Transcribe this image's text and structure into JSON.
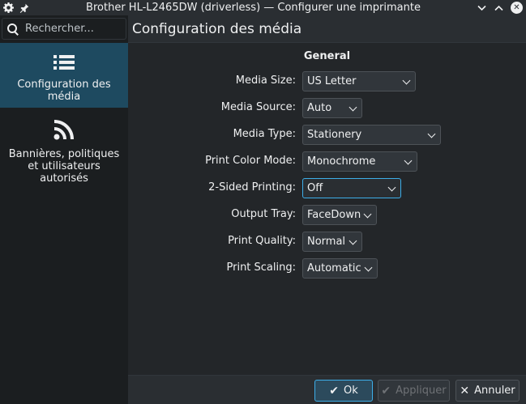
{
  "window": {
    "title": "Brother HL-L2465DW (driverless) — Configurer une imprimante",
    "icons": [
      "gear-icon",
      "pin-icon",
      "chevron-down-icon",
      "chevron-up-icon",
      "close-icon"
    ]
  },
  "sidebar": {
    "search_placeholder": "Rechercher...",
    "items": [
      {
        "label": "Configuration des média",
        "icon": "list-icon",
        "active": true
      },
      {
        "label": "Bannières, politiques et utilisateurs autorisés",
        "icon": "rss-icon",
        "active": false
      }
    ]
  },
  "page": {
    "title": "Configuration des média",
    "section": "General",
    "fields": [
      {
        "label": "Media Size:",
        "value": "US Letter"
      },
      {
        "label": "Media Source:",
        "value": "Auto"
      },
      {
        "label": "Media Type:",
        "value": "Stationery"
      },
      {
        "label": "Print Color Mode:",
        "value": "Monochrome"
      },
      {
        "label": "2-Sided Printing:",
        "value": "Off"
      },
      {
        "label": "Output Tray:",
        "value": "FaceDown"
      },
      {
        "label": "Print Quality:",
        "value": "Normal"
      },
      {
        "label": "Print Scaling:",
        "value": "Automatic"
      }
    ]
  },
  "buttons": {
    "ok": "Ok",
    "apply": "Appliquer",
    "cancel": "Annuler"
  },
  "colors": {
    "accent": "#3daee9",
    "selected_sidebar": "#1e4a60",
    "background": "#232629"
  }
}
